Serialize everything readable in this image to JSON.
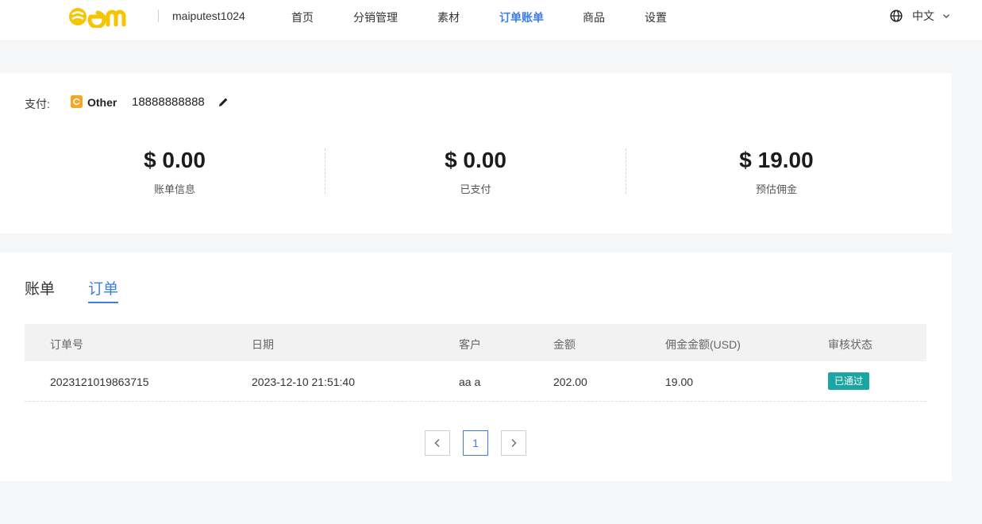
{
  "header": {
    "store_name": "maiputest1024",
    "nav": [
      {
        "label": "首页"
      },
      {
        "label": "分销管理"
      },
      {
        "label": "素材"
      },
      {
        "label": "订单账单",
        "active": true
      },
      {
        "label": "商品"
      },
      {
        "label": "设置"
      }
    ],
    "language": "中文",
    "brand_color": "#f6c400",
    "accent_color": "#3d7de6"
  },
  "payment": {
    "label": "支付:",
    "method": "Other",
    "account": "18888888888",
    "icon": "wallet-icon"
  },
  "stats": [
    {
      "amount": "$ 0.00",
      "label": "账单信息"
    },
    {
      "amount": "$ 0.00",
      "label": "已支付"
    },
    {
      "amount": "$ 19.00",
      "label": "预估佣金"
    }
  ],
  "tabs": [
    {
      "label": "账单",
      "active": false
    },
    {
      "label": "订单",
      "active": true
    }
  ],
  "orders_table": {
    "columns": [
      "订单号",
      "日期",
      "客户",
      "金额",
      "佣金金额(USD)",
      "审核状态"
    ],
    "rows": [
      {
        "order_no": "2023121019863715",
        "date": "2023-12-10 21:51:40",
        "customer": "aa a",
        "amount": "202.00",
        "commission": "19.00",
        "status": "已通过",
        "status_color": "#1aa7a3"
      }
    ]
  },
  "pagination": {
    "current_page": "1"
  }
}
